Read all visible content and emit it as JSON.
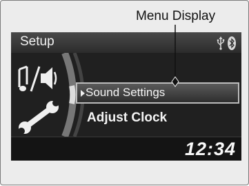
{
  "callout": {
    "label": "Menu Display"
  },
  "header": {
    "title": "Setup",
    "icons": [
      "usb-icon",
      "bluetooth-icon"
    ]
  },
  "side_icons": [
    "music-note-speaker-icon",
    "wrench-icon"
  ],
  "menu": {
    "items": [
      {
        "label": "Sound Settings",
        "selected": true
      },
      {
        "label": "Adjust Clock",
        "selected": false
      }
    ]
  },
  "footer": {
    "clock": "12:34"
  },
  "colors": {
    "screen_bg": "#1b1b1b",
    "header_bg": "#3a3a3a",
    "frame_bg": "#ececec",
    "text": "#f5f5f5"
  }
}
